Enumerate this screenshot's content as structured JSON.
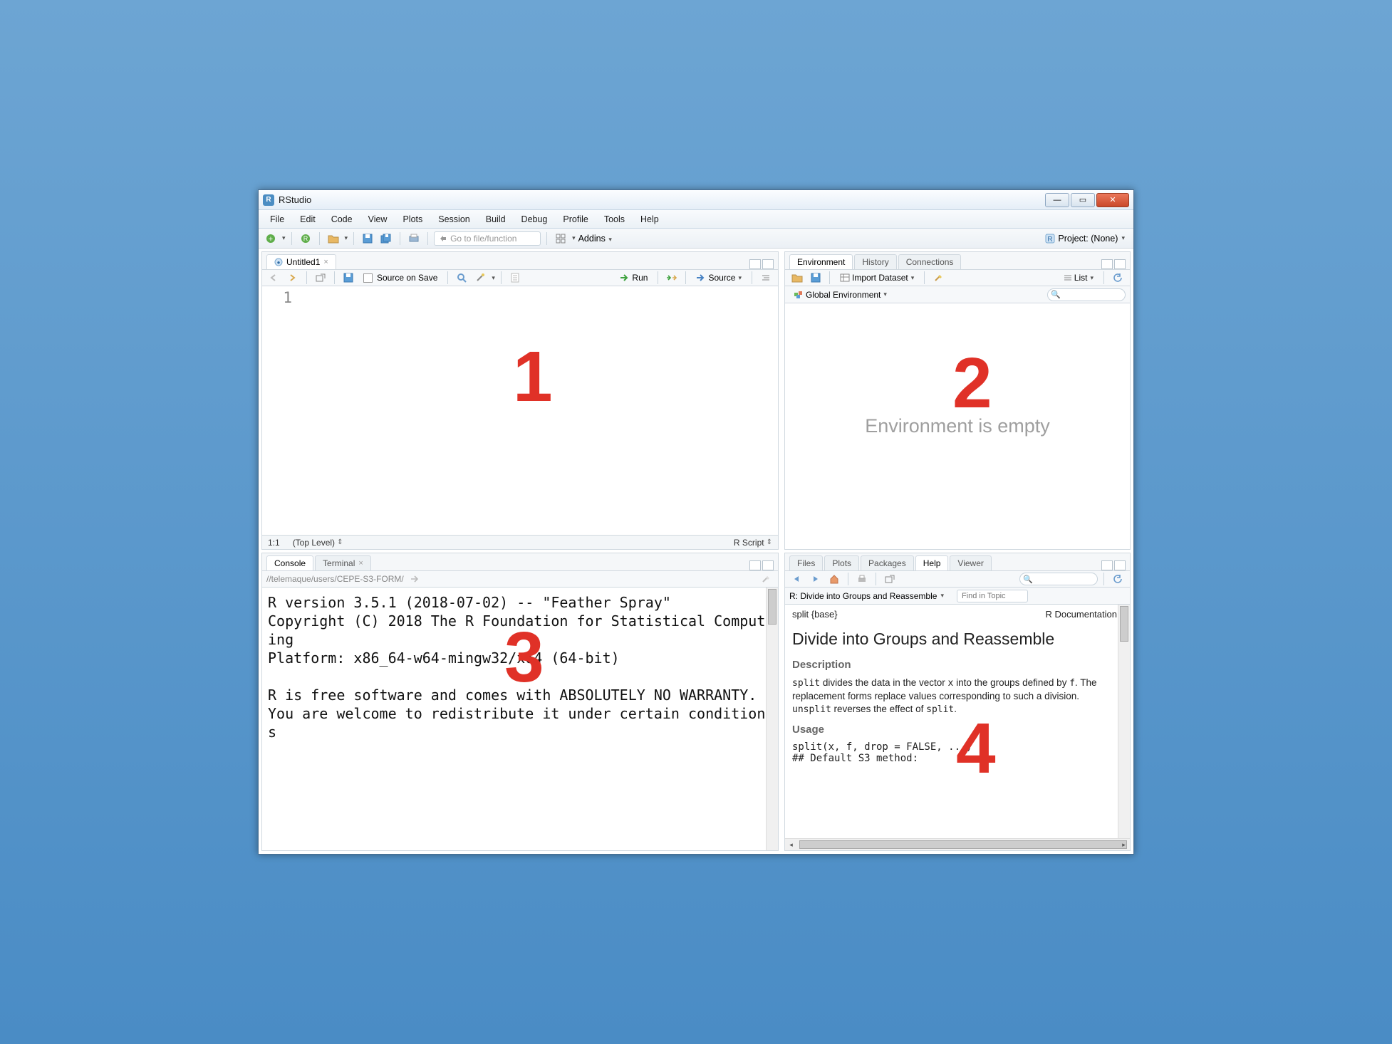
{
  "app": {
    "title": "RStudio"
  },
  "menus": [
    "File",
    "Edit",
    "Code",
    "View",
    "Plots",
    "Session",
    "Build",
    "Debug",
    "Profile",
    "Tools",
    "Help"
  ],
  "toolbar": {
    "goto_placeholder": "Go to file/function",
    "addins": "Addins",
    "project": "Project: (None)"
  },
  "source": {
    "tab_title": "Untitled1",
    "source_on_save": "Source on Save",
    "run": "Run",
    "source_btn": "Source",
    "line_no": "1",
    "cursor": "1:1",
    "scope": "(Top Level)",
    "mode": "R Script"
  },
  "console": {
    "tabs": [
      "Console",
      "Terminal"
    ],
    "wd": "//telemaque/users/CEPE-S3-FORM/",
    "text": "R version 3.5.1 (2018-07-02) -- \"Feather Spray\"\nCopyright (C) 2018 The R Foundation for Statistical Computing\nPlatform: x86_64-w64-mingw32/x64 (64-bit)\n\nR is free software and comes with ABSOLUTELY NO WARRANTY.\nYou are welcome to redistribute it under certain conditions"
  },
  "env": {
    "tabs": [
      "Environment",
      "History",
      "Connections"
    ],
    "import": "Import Dataset",
    "scope": "Global Environment",
    "list": "List",
    "empty_msg": "Environment is empty"
  },
  "help": {
    "tabs": [
      "Files",
      "Plots",
      "Packages",
      "Help",
      "Viewer"
    ],
    "topic_selector": "R: Divide into Groups and Reassemble",
    "find_placeholder": "Find in Topic",
    "pkgfn": "split {base}",
    "rdoc": "R Documentation",
    "title": "Divide into Groups and Reassemble",
    "desc_h": "Description",
    "desc_p1": "split",
    "desc_p_mid": " divides the data in the vector ",
    "desc_x": "x",
    "desc_p_mid2": " into the groups defined by ",
    "desc_f": "f",
    "desc_p_tail": ". The replacement forms replace values corresponding to such a division. ",
    "desc_unsplit": "unsplit",
    "desc_rev": " reverses the effect of ",
    "desc_split2": "split",
    "desc_dot": ".",
    "usage_h": "Usage",
    "usage_code": "split(x, f, drop = FALSE, ...)\n## Default S3 method:"
  },
  "overlays": {
    "n1": "1",
    "n2": "2",
    "n3": "3",
    "n4": "4"
  }
}
